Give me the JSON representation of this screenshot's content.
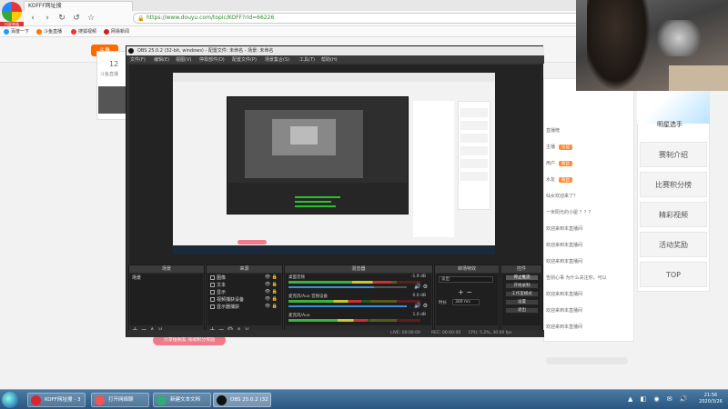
{
  "browser": {
    "tab_title": "KOFFF网址搜",
    "app_label": "抖屏神器",
    "url": "https://www.douyu.com/topic/KOFF?rid=66226",
    "nav_icons": [
      "back",
      "forward",
      "refresh",
      "undo",
      "star"
    ],
    "bookmarks": [
      "百度一下",
      "斗鱼直播",
      "搜狐视频",
      "网易新闻"
    ]
  },
  "page": {
    "logo": "斗鱼",
    "room_number": "12",
    "room_sub": "斗鱼直播",
    "sidebar_banner_text": "明星选手",
    "sidebar_items": [
      "赛制介绍",
      "比赛积分榜",
      "精彩视频",
      "活动奖励",
      "TOP"
    ],
    "chat_lines": [
      {
        "text": "直播榜",
        "badge": ""
      },
      {
        "text": "主播",
        "badge": "认证"
      },
      {
        "text": "用户",
        "badge": "粉丝"
      },
      {
        "text": "水友",
        "badge": "粉丝"
      },
      {
        "text": "仙女欢迎来了？",
        "badge": ""
      },
      {
        "text": "一米阳光的小屋 ？？？",
        "badge": ""
      },
      {
        "text": "欢迎来到本直播间",
        "badge": ""
      },
      {
        "text": "欢迎来到本直播间",
        "badge": ""
      },
      {
        "text": "欢迎来到本直播间",
        "badge": ""
      },
      {
        "text": "告别心事  为什么关注你，可以",
        "badge": ""
      },
      {
        "text": "欢迎来到本直播间",
        "badge": ""
      },
      {
        "text": "欢迎来到本直播间",
        "badge": ""
      },
      {
        "text": "欢迎来到本直播间",
        "badge": ""
      }
    ],
    "pink_button": "分享给朋友 领取积分奖励"
  },
  "obs": {
    "title": "OBS 25.0.2 (32-bit, windows) - 配置文件: 未命名 - 场景: 未命名",
    "menu": [
      "文件(F)",
      "编辑(E)",
      "视图(V)",
      "停靠部件(D)",
      "配置文件(P)",
      "场景集合(S)",
      "工具(T)",
      "帮助(H)"
    ],
    "docks": {
      "scenes": {
        "header": "场景",
        "items": [
          "场景"
        ]
      },
      "sources": {
        "header": "来源",
        "items": [
          {
            "name": "图像",
            "icon": "image-icon"
          },
          {
            "name": "文本",
            "icon": "text-icon"
          },
          {
            "name": "显示",
            "icon": "display-icon"
          },
          {
            "name": "视频捕获设备",
            "icon": "camera-icon"
          },
          {
            "name": "显示器捕获",
            "icon": "monitor-icon"
          }
        ]
      },
      "mixer": {
        "header": "混音器",
        "tracks": [
          {
            "name": "桌面音频",
            "db": "-1.9 dB",
            "level": 0.78,
            "volume": 0.72
          },
          {
            "name": "麦克风/Aux 音频设备",
            "db": "0.0 dB",
            "level": 0.55,
            "volume": 1.0
          },
          {
            "name": "麦克风/Aux",
            "db": "1.0 dB",
            "level": 0.6,
            "volume": 1.0
          }
        ]
      },
      "transitions": {
        "header": "转场特效",
        "type": "淡出",
        "duration_label": "时长",
        "duration": "300 ms"
      },
      "controls": {
        "header": "控件",
        "buttons": [
          "停止推流",
          "开始录制",
          "工作室模式",
          "设置",
          "退出"
        ]
      }
    },
    "status": {
      "live": "LIVE: 00:00:00",
      "rec": "REC: 00:00:00",
      "cpu": "CPU: 5.2%, 30.00 fps"
    }
  },
  "taskbar": {
    "tasks": [
      {
        "label": "KOFF网址搜 - 3",
        "color": "#d23"
      },
      {
        "label": "打开网络聊",
        "color": "#e55"
      },
      {
        "label": "新建文本文档",
        "color": "#3a7"
      },
      {
        "label": "OBS 25.0.2 (32",
        "color": "#111"
      }
    ],
    "time": "21:56",
    "date": "2020/3/26"
  }
}
